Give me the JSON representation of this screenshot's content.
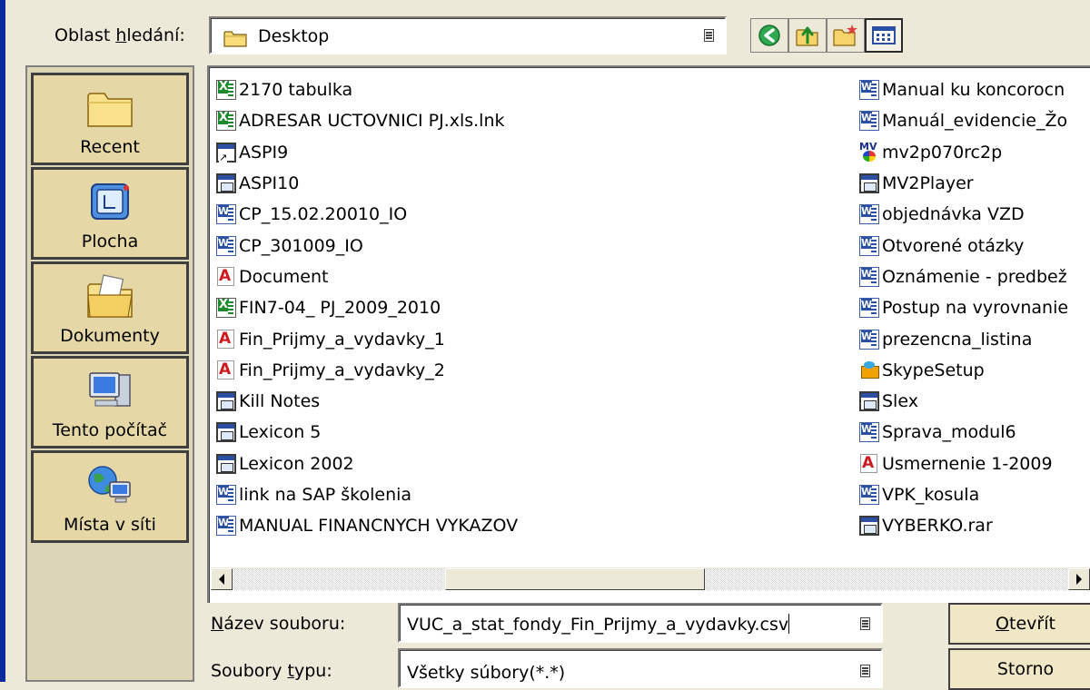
{
  "lookin": {
    "label_prefix": "Oblast ",
    "label_key": "h",
    "label_rest": "ledání:",
    "value": "Desktop"
  },
  "toolbar": {
    "buttons": [
      "back-icon",
      "up-folder-icon",
      "new-folder-icon",
      "view-menu-icon"
    ]
  },
  "places": [
    {
      "label": "Recent",
      "icon": "recent-folder-icon"
    },
    {
      "label": "Plocha",
      "icon": "desktop-icon"
    },
    {
      "label": "Dokumenty",
      "icon": "documents-folder-icon"
    },
    {
      "label": "Tento počítač",
      "icon": "my-computer-icon"
    },
    {
      "label": "Místa v síti",
      "icon": "network-places-icon"
    }
  ],
  "files_col1": [
    {
      "name": "2170 tabulka",
      "type": "xls"
    },
    {
      "name": "ADRESAR UCTOVNICI PJ.xls.lnk",
      "type": "xls"
    },
    {
      "name": "ASPI9",
      "type": "lnk"
    },
    {
      "name": "ASPI10",
      "type": "app"
    },
    {
      "name": "CP_15.02.20010_IO",
      "type": "doc"
    },
    {
      "name": "CP_301009_IO",
      "type": "doc"
    },
    {
      "name": "Document",
      "type": "pdf"
    },
    {
      "name": "FIN7-04_ PJ_2009_2010",
      "type": "xls"
    },
    {
      "name": "Fin_Prijmy_a_vydavky_1",
      "type": "pdf"
    },
    {
      "name": "Fin_Prijmy_a_vydavky_2",
      "type": "pdf"
    },
    {
      "name": "Kill Notes",
      "type": "app"
    },
    {
      "name": "Lexicon 5",
      "type": "app"
    },
    {
      "name": "Lexicon 2002",
      "type": "app"
    },
    {
      "name": "link na SAP školenia",
      "type": "doc"
    },
    {
      "name": "MANUAL FINANCNYCH VYKAZOV",
      "type": "doc"
    }
  ],
  "files_col2": [
    {
      "name": "Manual ku koncorocn",
      "type": "doc"
    },
    {
      "name": "Manuál_evidencie_Žo",
      "type": "doc"
    },
    {
      "name": "mv2p070rc2p",
      "type": "mv"
    },
    {
      "name": "MV2Player",
      "type": "app"
    },
    {
      "name": "objednávka VZD",
      "type": "doc"
    },
    {
      "name": "Otvorené otázky",
      "type": "doc"
    },
    {
      "name": "Oznámenie - predbež",
      "type": "doc"
    },
    {
      "name": "Postup na vyrovnanie",
      "type": "doc"
    },
    {
      "name": "prezencna_listina",
      "type": "doc"
    },
    {
      "name": "SkypeSetup",
      "type": "skype"
    },
    {
      "name": "Slex",
      "type": "app"
    },
    {
      "name": "Sprava_modul6",
      "type": "doc"
    },
    {
      "name": "Usmernenie 1-2009",
      "type": "pdf"
    },
    {
      "name": "VPK_kosula",
      "type": "doc"
    },
    {
      "name": "VYBERKO.rar",
      "type": "app"
    }
  ],
  "filename": {
    "label_key": "N",
    "label_rest": "ázev souboru:",
    "value": "VUC_a_stat_fondy_Fin_Prijmy_a_vydavky.csv"
  },
  "filetype": {
    "label_prefix": "Soubory ",
    "label_key": "t",
    "label_rest": "ypu:",
    "value": "Všetky súbory(*.*)"
  },
  "buttons": {
    "open_key": "O",
    "open_rest": "tevřít",
    "cancel": "Storno"
  }
}
